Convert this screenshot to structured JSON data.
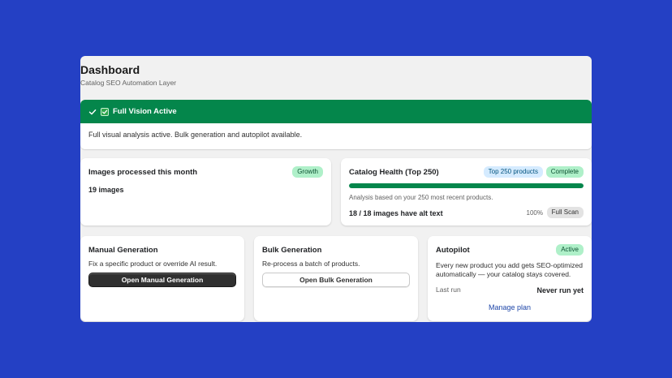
{
  "header": {
    "title": "Dashboard",
    "subtitle": "Catalog SEO Automation Layer"
  },
  "banner": {
    "title": "Full Vision Active",
    "message": "Full visual analysis active. Bulk generation and autopilot available.",
    "color": "#04864b"
  },
  "images_card": {
    "title": "Images processed this month",
    "badge": "Growth",
    "value": "19 images"
  },
  "health_card": {
    "title": "Catalog Health (Top 250)",
    "badge_scope": "Top 250 products",
    "badge_status": "Complete",
    "progress_percent": 100,
    "note": "Analysis based on your 250 most recent products.",
    "summary": "18 / 18 images have alt text",
    "percent_label": "100%",
    "scan_badge": "Full Scan"
  },
  "manual_card": {
    "title": "Manual Generation",
    "description": "Fix a specific product or override AI result.",
    "button_label": "Open Manual Generation"
  },
  "bulk_card": {
    "title": "Bulk Generation",
    "description": "Re-process a batch of products.",
    "button_label": "Open Bulk Generation"
  },
  "autopilot_card": {
    "title": "Autopilot",
    "badge": "Active",
    "description": "Every new product you add gets SEO-optimized automatically — your catalog stays covered.",
    "last_run_label": "Last run",
    "last_run_value": "Never run yet",
    "link_label": "Manage plan"
  },
  "colors": {
    "background": "#2440c4",
    "success": "#04864b",
    "badge_green": "#aff0c9",
    "badge_blue": "#d5ebff",
    "link": "#1d45a8"
  },
  "icons": [
    "check-icon",
    "checkbox-icon"
  ]
}
